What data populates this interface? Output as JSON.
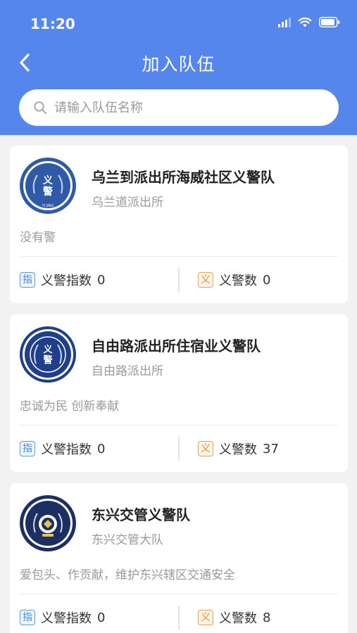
{
  "status_bar": {
    "time": "11:20"
  },
  "nav": {
    "title": "加入队伍",
    "back_icon": "chevron-left-icon"
  },
  "search": {
    "placeholder": "请输入队伍名称",
    "value": ""
  },
  "labels": {
    "index_badge": "指",
    "count_badge": "义",
    "index_label": "义警指数",
    "count_label": "义警数"
  },
  "teams": [
    {
      "name": "乌兰到派出所海威社区义警队",
      "station": "乌兰道派出所",
      "motto": "没有警",
      "index": "0",
      "count": "0",
      "logo_text": "义警",
      "logo_sub": "YI JING"
    },
    {
      "name": "自由路派出所住宿业义警队",
      "station": "自由路派出所",
      "motto": "忠诚为民 创新奉献",
      "index": "0",
      "count": "37",
      "logo_text": "义警",
      "logo_sub": ""
    },
    {
      "name": "东兴交管义警队",
      "station": "东兴交管大队",
      "motto": "爱包头、作贡献，维护东兴辖区交通安全",
      "index": "0",
      "count": "8",
      "logo_text": "",
      "logo_sub": ""
    }
  ],
  "colors": {
    "header": "#5486ec",
    "index_badge": "#4a89d3",
    "count_badge": "#e08b2c"
  }
}
